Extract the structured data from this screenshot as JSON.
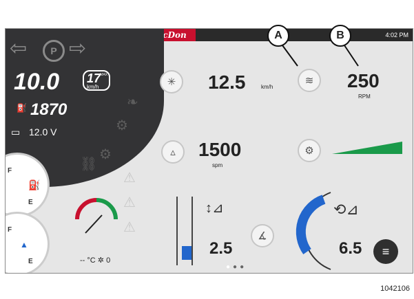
{
  "brand": "MacDon",
  "clock": "4:02 PM",
  "callouts": [
    "A",
    "B"
  ],
  "left_panel": {
    "ground_speed": "10.0",
    "speed_limit": "17",
    "speed_limit_unit": "km/h",
    "speed_limit_tag": "MAX",
    "engine_rpm": "1870",
    "battery_voltage": "12.0 V"
  },
  "gauges": {
    "fuel_full": "F",
    "fuel_empty": "E",
    "def_full": "F",
    "def_empty": "E",
    "temp_readout": "-- °C",
    "fan_readout": "0"
  },
  "main": {
    "ground_speed_value": "12.5",
    "ground_speed_unit": "km/h",
    "reel_speed_value": "250",
    "reel_speed_unit": "RPM",
    "knife_speed_value": "1500",
    "knife_speed_unit": "spm",
    "header_height_value": "2.5",
    "header_tilt_value": "6.5"
  },
  "figure_number": "1042106",
  "colors": {
    "brand_red": "#c8102e",
    "accent_blue": "#2266cc",
    "torque_green": "#1a9a4a"
  }
}
